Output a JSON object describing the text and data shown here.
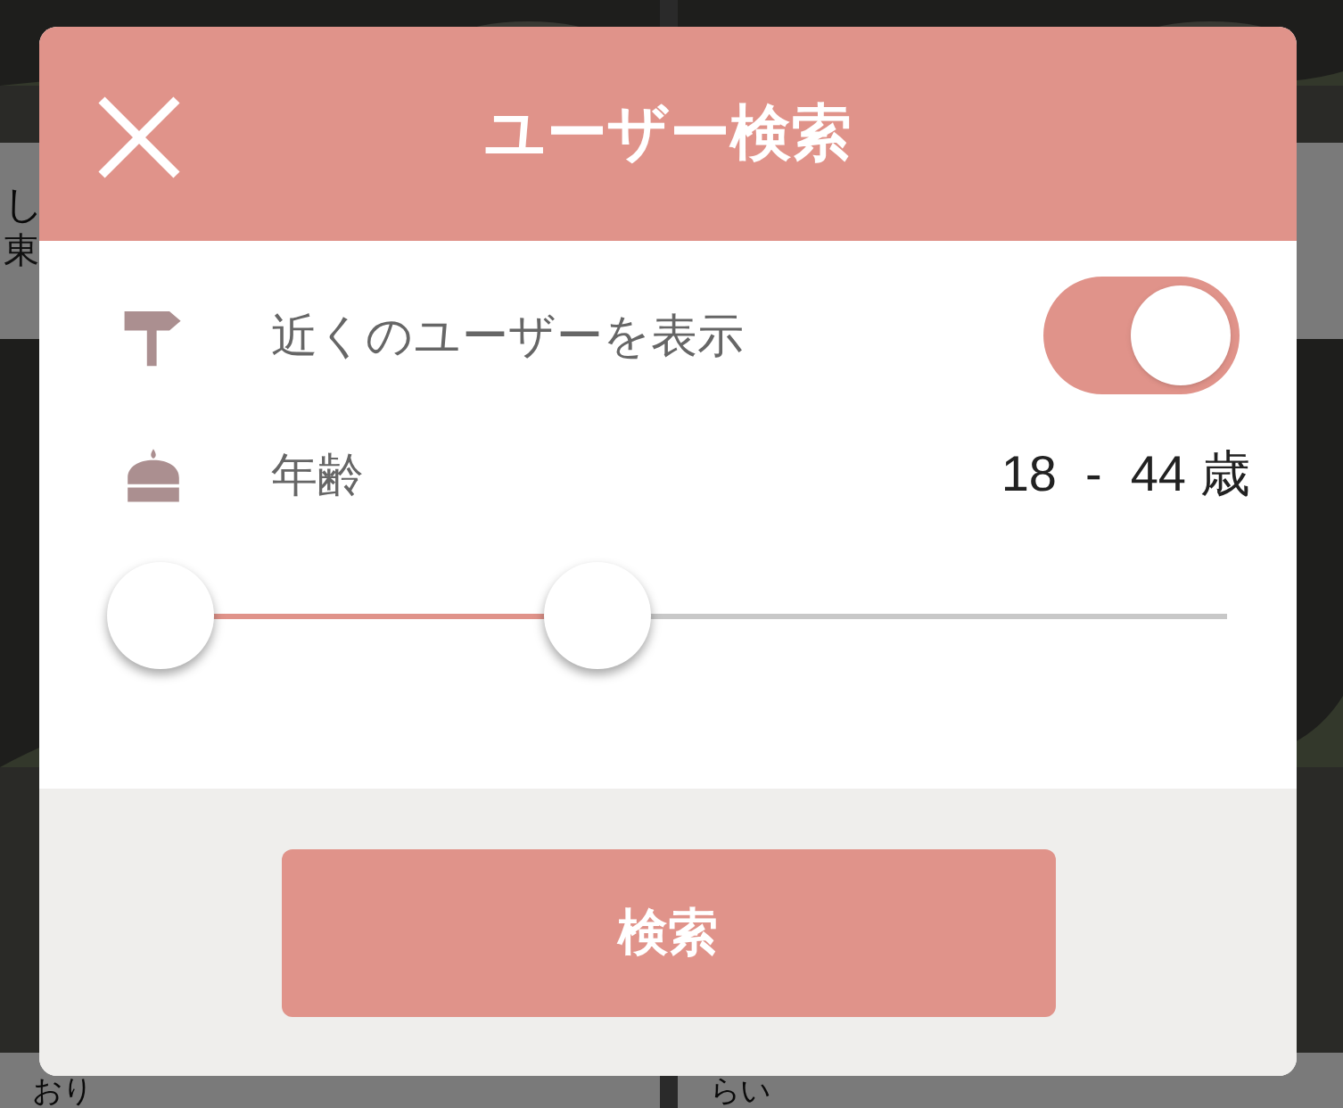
{
  "background": {
    "cards": [
      {
        "name": "し",
        "location": "東"
      },
      {
        "name": "おり"
      },
      {
        "name": "らい"
      }
    ]
  },
  "dialog": {
    "title": "ユーザー検索",
    "nearby": {
      "label": "近くのユーザーを表示",
      "on": true
    },
    "age": {
      "label": "年齢",
      "min": "18",
      "separator": "-",
      "max": "44",
      "unit": "歳",
      "thumbs": [
        {
          "level": 0
        },
        {
          "level": 0.41
        }
      ]
    },
    "search_button": "検索"
  }
}
